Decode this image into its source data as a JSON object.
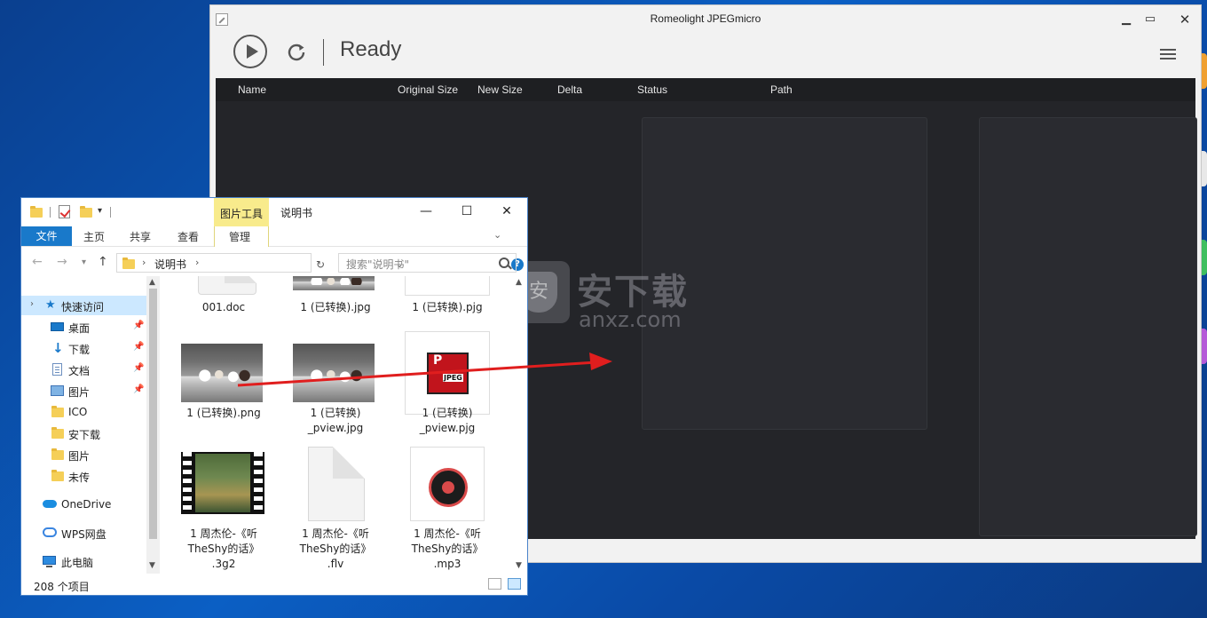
{
  "jpegmicro": {
    "title": "Romeolight JPEGmicro",
    "status": "Ready",
    "columns": [
      "Name",
      "Original Size",
      "New Size",
      "Delta",
      "Status",
      "Path"
    ]
  },
  "watermark": {
    "brand": "安下载",
    "domain": "anxz.com",
    "shield_char": "安"
  },
  "explorer": {
    "context_tab": "图片工具",
    "title": "说明书",
    "ribbon": {
      "file": "文件",
      "home": "主页",
      "share": "共享",
      "view": "查看",
      "manage": "管理"
    },
    "address": {
      "path": "说明书"
    },
    "search": {
      "placeholder": "搜索\"说明书\""
    },
    "sidebar": {
      "quick_access": "快速访问",
      "items": [
        {
          "label": "桌面",
          "icon": "desktop-icon",
          "pinned": true
        },
        {
          "label": "下载",
          "icon": "download-icon",
          "pinned": true
        },
        {
          "label": "文档",
          "icon": "document-icon",
          "pinned": true
        },
        {
          "label": "图片",
          "icon": "pictures-icon",
          "pinned": true
        },
        {
          "label": "ICO",
          "icon": "folder-icon",
          "pinned": false
        },
        {
          "label": "安下载",
          "icon": "folder-icon",
          "pinned": false
        },
        {
          "label": "图片",
          "icon": "folder-icon",
          "pinned": false
        },
        {
          "label": "未传",
          "icon": "folder-icon",
          "pinned": false
        }
      ],
      "onedrive": "OneDrive",
      "wps": "WPS网盘",
      "this_pc": "此电脑"
    },
    "files": [
      {
        "name": "001.doc"
      },
      {
        "name": "1 (已转换).jpg"
      },
      {
        "name": "1 (已转换).pjg"
      },
      {
        "name": "1 (已转换).png"
      },
      {
        "name": "1 (已转换)\n_pview.jpg"
      },
      {
        "name": "1 (已转换)\n_pview.pjg"
      },
      {
        "name": "1 周杰伦-《听\nTheShy的话》\n.3g2"
      },
      {
        "name": "1 周杰伦-《听\nTheShy的话》\n.flv"
      },
      {
        "name": "1 周杰伦-《听\nTheShy的话》\n.mp3"
      }
    ],
    "item_count": "208 个项目"
  },
  "colors": {
    "accent": "#1979ca",
    "arrow": "#e01e1e",
    "context_tab": "#f8eb8c",
    "table_bg": "#242529"
  }
}
